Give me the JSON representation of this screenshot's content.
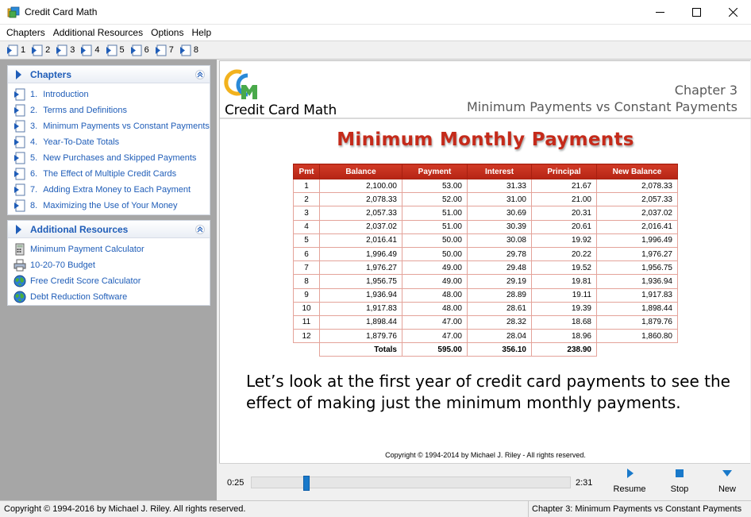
{
  "window": {
    "title": "Credit Card Math"
  },
  "menu": [
    "Chapters",
    "Additional Resources",
    "Options",
    "Help"
  ],
  "toolbar": [
    "1",
    "2",
    "3",
    "4",
    "5",
    "6",
    "7",
    "8"
  ],
  "chapters_panel": {
    "title": "Chapters",
    "items": [
      {
        "num": "1.",
        "label": "Introduction"
      },
      {
        "num": "2.",
        "label": "Terms and Definitions"
      },
      {
        "num": "3.",
        "label": "Minimum Payments vs Constant Payments"
      },
      {
        "num": "4.",
        "label": "Year-To-Date Totals"
      },
      {
        "num": "5.",
        "label": "New Purchases and Skipped Payments"
      },
      {
        "num": "6.",
        "label": "The Effect of Multiple Credit Cards"
      },
      {
        "num": "7.",
        "label": "Adding Extra Money to Each Payment"
      },
      {
        "num": "8.",
        "label": "Maximizing the Use of Your Money"
      }
    ]
  },
  "resources_panel": {
    "title": "Additional Resources",
    "items": [
      {
        "label": "Minimum Payment Calculator",
        "icon": "calculator-icon"
      },
      {
        "label": "10-20-70 Budget",
        "icon": "printer-icon"
      },
      {
        "label": "Free Credit Score Calculator",
        "icon": "globe-icon"
      },
      {
        "label": "Debt Reduction Software",
        "icon": "globe-icon"
      }
    ]
  },
  "slide": {
    "logo_text": "Credit Card Math",
    "chapter_number": "Chapter 3",
    "chapter_name": "Minimum Payments vs Constant Payments",
    "title": "Minimum Monthly Payments",
    "table": {
      "headers": [
        "Pmt",
        "Balance",
        "Payment",
        "Interest",
        "Principal",
        "New Balance"
      ],
      "rows": [
        [
          "1",
          "2,100.00",
          "53.00",
          "31.33",
          "21.67",
          "2,078.33"
        ],
        [
          "2",
          "2,078.33",
          "52.00",
          "31.00",
          "21.00",
          "2,057.33"
        ],
        [
          "3",
          "2,057.33",
          "51.00",
          "30.69",
          "20.31",
          "2,037.02"
        ],
        [
          "4",
          "2,037.02",
          "51.00",
          "30.39",
          "20.61",
          "2,016.41"
        ],
        [
          "5",
          "2,016.41",
          "50.00",
          "30.08",
          "19.92",
          "1,996.49"
        ],
        [
          "6",
          "1,996.49",
          "50.00",
          "29.78",
          "20.22",
          "1,976.27"
        ],
        [
          "7",
          "1,976.27",
          "49.00",
          "29.48",
          "19.52",
          "1,956.75"
        ],
        [
          "8",
          "1,956.75",
          "49.00",
          "29.19",
          "19.81",
          "1,936.94"
        ],
        [
          "9",
          "1,936.94",
          "48.00",
          "28.89",
          "19.11",
          "1,917.83"
        ],
        [
          "10",
          "1,917.83",
          "48.00",
          "28.61",
          "19.39",
          "1,898.44"
        ],
        [
          "11",
          "1,898.44",
          "47.00",
          "28.32",
          "18.68",
          "1,879.76"
        ],
        [
          "12",
          "1,879.76",
          "47.00",
          "28.04",
          "18.96",
          "1,860.80"
        ]
      ],
      "totals": {
        "label": "Totals",
        "payment": "595.00",
        "interest": "356.10",
        "principal": "238.90"
      }
    },
    "body": "Let’s look at the first year of credit card payments to see the effect of making just the minimum monthly payments.",
    "copyright": "Copyright © 1994-2014  by Michael J. Riley - All rights reserved."
  },
  "player": {
    "elapsed": "0:25",
    "total": "2:31",
    "progress": 0.165,
    "buttons": [
      "Resume",
      "Stop",
      "New"
    ]
  },
  "status": {
    "left": "Copyright © 1994-2016 by Michael J. Riley. All rights reserved.",
    "right": "Chapter 3:  Minimum Payments vs Constant Payments"
  },
  "colors": {
    "link": "#1f5db8",
    "title_red": "#c52a1a",
    "table_header": "#c22e1d",
    "accent_blue": "#1979ca"
  }
}
